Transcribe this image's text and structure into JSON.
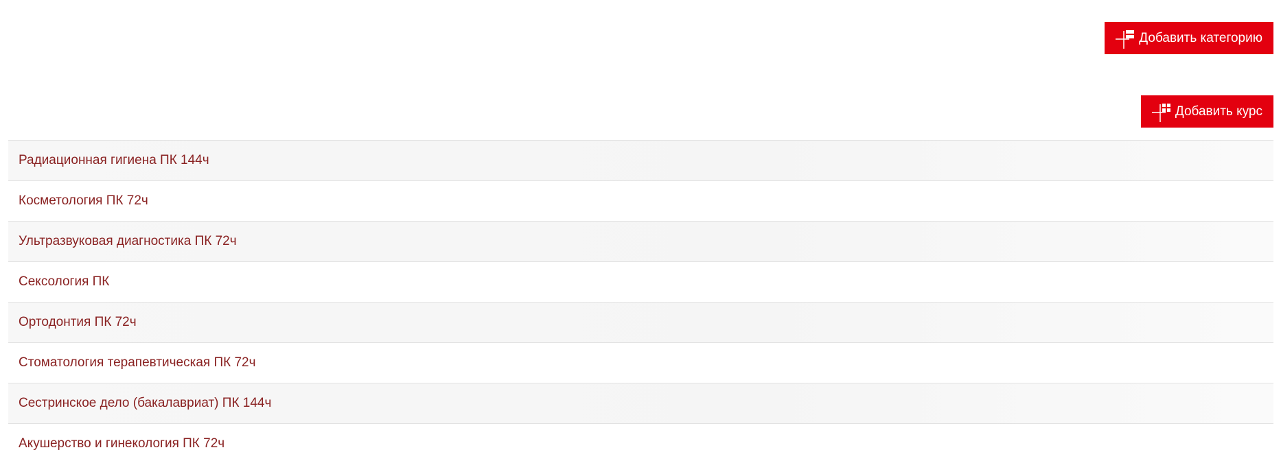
{
  "toolbar": {
    "add_category_label": "Добавить категорию",
    "add_course_label": "Добавить курс",
    "button_color": "#e3000f"
  },
  "courses": [
    {
      "title": "Радиационная гигиена ПК 144ч"
    },
    {
      "title": "Косметология ПК 72ч"
    },
    {
      "title": "Ультразвуковая диагностика ПК 72ч"
    },
    {
      "title": "Сексология ПК"
    },
    {
      "title": "Ортодонтия ПК 72ч"
    },
    {
      "title": "Стоматология терапевтическая ПК 72ч"
    },
    {
      "title": "Сестринское дело (бакалавриат) ПК 144ч"
    },
    {
      "title": "Акушерство и гинекология ПК 72ч"
    }
  ],
  "colors": {
    "link": "#8a2222",
    "row_alt": "#f7f7f7",
    "divider": "#e2e2e2"
  }
}
